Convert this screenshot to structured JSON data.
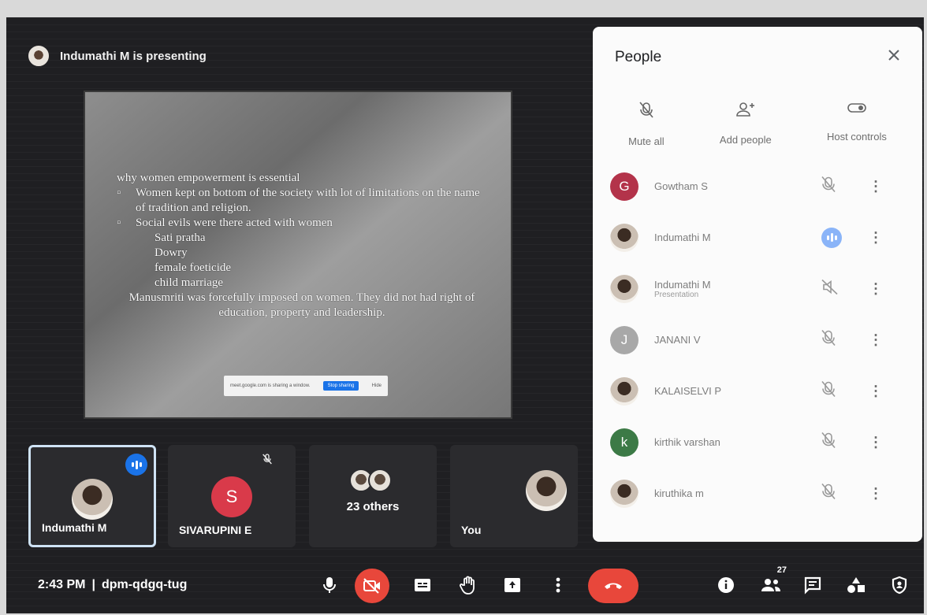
{
  "presenting_banner": "Indumathi M is presenting",
  "slide": {
    "heading": "why women empowerment is essential",
    "bullets": [
      "Women kept on bottom of the society with lot of limitations on the name of tradition and religion.",
      "Social evils were there acted with women"
    ],
    "sub_items": [
      "Sati pratha",
      "Dowry",
      "female foeticide",
      "child marriage"
    ],
    "closing": "Manusmriti was forcefully imposed on women. They did not had right of education, property and leadership.",
    "share_bar_text": "meet.google.com is sharing a window.",
    "stop_sharing_label": "Stop sharing",
    "hide_label": "Hide"
  },
  "tiles": [
    {
      "name": "Indumathi M"
    },
    {
      "name": "SIVARUPINI E",
      "initial": "S"
    },
    {
      "name": "23 others"
    },
    {
      "name": "You"
    }
  ],
  "meeting": {
    "time": "2:43 PM",
    "separator": "|",
    "code": "dpm-qdgq-tug"
  },
  "people_count": "27",
  "panel": {
    "title": "People",
    "close_icon": "close-icon",
    "actions": [
      {
        "label": "Mute all",
        "icon": "mic-off-icon"
      },
      {
        "label": "Add people",
        "icon": "add-person-icon"
      },
      {
        "label": "Host controls",
        "icon": "toggle-icon"
      }
    ],
    "participants": [
      {
        "name": "Gowtham S",
        "initial": "G",
        "color": "#b3334a",
        "status": "muted"
      },
      {
        "name": "Indumathi M",
        "initial": "",
        "color": "#5a4233",
        "status": "speaking"
      },
      {
        "name": "Indumathi M",
        "sub": "Presentation",
        "initial": "",
        "color": "#5a4233",
        "status": "muted-presentation"
      },
      {
        "name": "JANANI V",
        "initial": "J",
        "color": "#a8a8a8",
        "status": "muted"
      },
      {
        "name": "KALAISELVI P",
        "initial": "",
        "color": "#7a5a48",
        "status": "muted"
      },
      {
        "name": "kirthik varshan",
        "initial": "k",
        "color": "#3c7a46",
        "status": "muted"
      },
      {
        "name": "kiruthika m",
        "initial": "",
        "color": "#6d5a52",
        "status": "muted"
      }
    ]
  },
  "colors": {
    "accent_blue": "#1a73e8",
    "end_call_red": "#e8473b"
  }
}
